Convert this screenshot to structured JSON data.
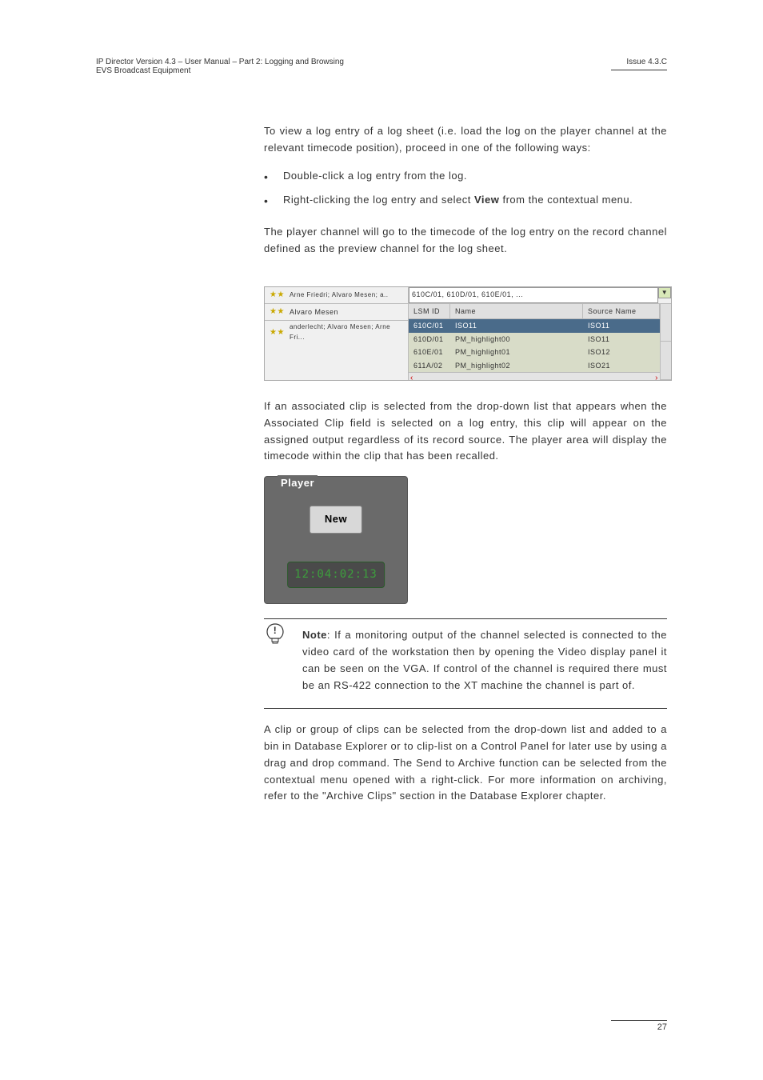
{
  "header": {
    "left_line1": "IP Director Version 4.3 – User Manual – Part 2: Logging and Browsing",
    "left_line2": "EVS Broadcast Equipment",
    "right": "Issue 4.3.C"
  },
  "body": {
    "p1": "To view a log entry of a log sheet (i.e. load the log on the player channel at the relevant timecode position), proceed in one of the following ways:",
    "bullet1": "Double-click a log entry from the log.",
    "bullet2_pre": "Right-clicking the log entry and select ",
    "bullet2_bold": "View",
    "bullet2_post": " from the contextual menu.",
    "p2": "The player channel will go to the timecode of the log entry on the record channel defined as the preview channel for the log sheet.",
    "p3": "If an associated clip is selected from the drop-down list that appears when the Associated Clip field is selected on a log entry, this clip will appear on the assigned output regardless of its record source. The player area will display the timecode within the clip that has been recalled.",
    "note_label": "Note",
    "note_text": "If a monitoring output of the channel selected is connected to the video card of the workstation then by opening the Video display panel it can be seen on the VGA. If control of the channel is required there must be an RS-422 connection to the XT machine the channel is part of.",
    "p4": "A clip or group of clips can be selected from the drop-down list and added to a bin in Database Explorer or to clip-list on a Control Panel for later use by using a drag and drop command. The Send to Archive function can be selected from the contextual menu opened with a right-click. For more information on archiving, refer to the \"Archive Clips\" section in the Database Explorer chapter."
  },
  "player": {
    "title": "Player",
    "new_btn": "New",
    "timecode": "12:04:02:13"
  },
  "table": {
    "left_rows": [
      "Arne Friedri; Alvaro Mesen; a..",
      "Alvaro Mesen",
      "anderlecht; Alvaro Mesen; Arne Fri..."
    ],
    "input_val": "610C/01, 610D/01, 610E/01, ...",
    "headers": {
      "lsm": "LSM ID",
      "name": "Name",
      "src": "Source Name"
    },
    "rows": [
      {
        "lsm": "610C/01",
        "name": "ISO11",
        "src": "ISO11",
        "hl": true
      },
      {
        "lsm": "610D/01",
        "name": "PM_highlight00",
        "src": "ISO11",
        "hl": false
      },
      {
        "lsm": "610E/01",
        "name": "PM_highlight01",
        "src": "ISO12",
        "hl": false
      },
      {
        "lsm": "611A/02",
        "name": "PM_highlight02",
        "src": "ISO21",
        "hl": false
      }
    ]
  },
  "footer": {
    "page": "27"
  }
}
